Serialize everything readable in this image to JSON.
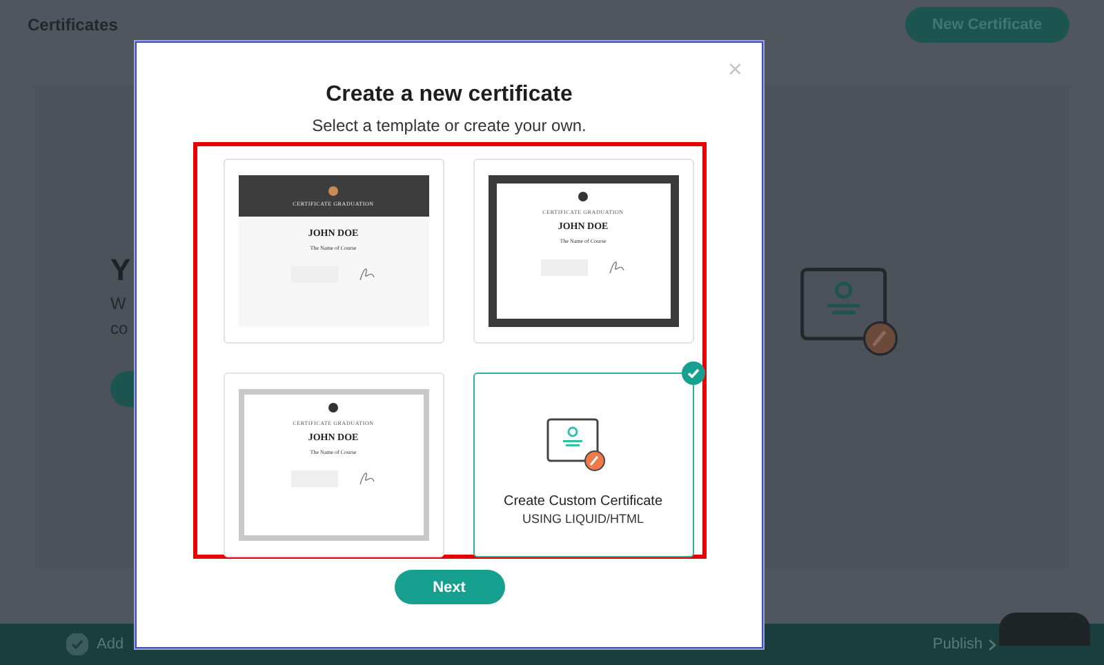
{
  "page": {
    "title": "Certificates",
    "new_button": "New Certificate",
    "hero_heading": "Y",
    "hero_text": [
      "W",
      "co"
    ]
  },
  "steps_bar": {
    "steps": [
      {
        "label": "Add",
        "done": true
      }
    ],
    "publish": "Publish"
  },
  "modal": {
    "title": "Create a new certificate",
    "subtitle": "Select a template or create your own.",
    "close": "×",
    "templates": [
      {
        "kind": "dark-header",
        "selected": false,
        "heading": "CERTIFICATE GRADUATION",
        "name": "JOHN DOE",
        "course": "The Name of Course"
      },
      {
        "kind": "dark-frame",
        "selected": false,
        "heading": "CERTIFICATE GRADUATION",
        "name": "JOHN DOE",
        "course": "The Name of Course"
      },
      {
        "kind": "corner-frame",
        "selected": false,
        "heading": "CERTIFICATE GRADUATION",
        "name": "JOHN DOE",
        "course": "The Name of Course"
      },
      {
        "kind": "custom",
        "selected": true,
        "title": "Create Custom Certificate",
        "subtitle": "USING LIQUID/HTML"
      }
    ],
    "next_button": "Next"
  }
}
